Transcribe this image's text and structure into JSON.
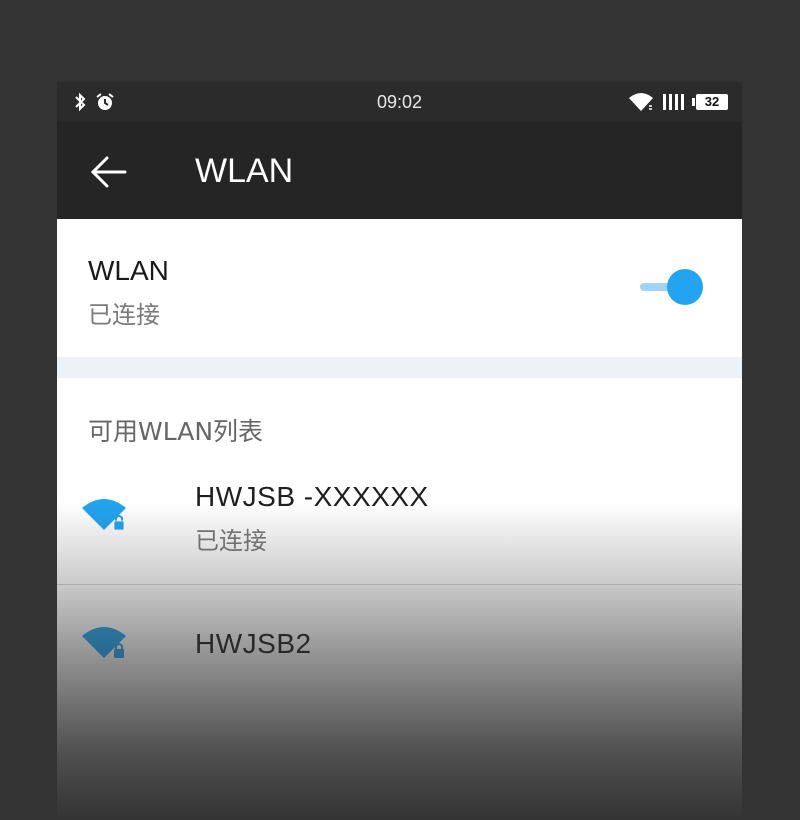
{
  "status_bar": {
    "time": "09:02",
    "battery": "32",
    "icons_left": [
      "bluetooth-icon",
      "alarm-icon"
    ],
    "icons_right": [
      "wifi-icon",
      "signal-icon",
      "battery-icon"
    ]
  },
  "app_bar": {
    "title": "WLAN",
    "back_icon": "arrow-left-icon"
  },
  "wlan_toggle": {
    "title": "WLAN",
    "status": "已连接",
    "enabled": true
  },
  "available_list": {
    "header": "可用WLAN列表",
    "networks": [
      {
        "name": "HWJSB -XXXXXX",
        "status": "已连接",
        "secured": true
      },
      {
        "name": "HWJSB2",
        "status": "",
        "secured": true
      }
    ]
  },
  "colors": {
    "accent": "#22a4f0",
    "accent_track": "#9fd3f3",
    "app_bar": "#252525",
    "background": "#333333"
  }
}
